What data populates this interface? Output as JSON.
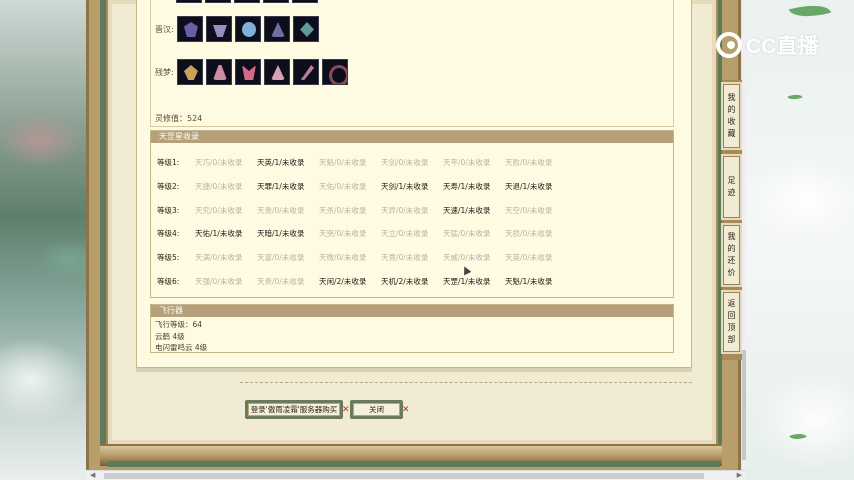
{
  "logo": {
    "text": "CC直播"
  },
  "items": {
    "row1_label": "晋汉:",
    "row1_icons": [
      "c1",
      "c2",
      "c3",
      "c4",
      "c5"
    ],
    "row2_label": "残梦:",
    "row2_icons": [
      "d1",
      "d2",
      "d3",
      "d4",
      "d5",
      "d6"
    ],
    "lingxiu": "灵修值：524"
  },
  "tianzhao": {
    "title": "天罡星收录",
    "rows": [
      {
        "label": "等级1:",
        "cells": [
          {
            "text": "天巧/0/未收录",
            "on": false
          },
          {
            "text": "天英/1/未收录",
            "on": true
          },
          {
            "text": "天魁/0/未收录",
            "on": false
          },
          {
            "text": "天剑/0/未收录",
            "on": false
          },
          {
            "text": "天平/0/未收录",
            "on": false
          },
          {
            "text": "天败/0/未收录",
            "on": false
          }
        ]
      },
      {
        "label": "等级2:",
        "cells": [
          {
            "text": "天捷/0/未收录",
            "on": false
          },
          {
            "text": "天罪/1/未收录",
            "on": true
          },
          {
            "text": "天佑/0/未收录",
            "on": false
          },
          {
            "text": "天剑/1/未收录",
            "on": true
          },
          {
            "text": "天寿/1/未收录",
            "on": true
          },
          {
            "text": "天退/1/未收录",
            "on": true
          }
        ]
      },
      {
        "label": "等级3:",
        "cells": [
          {
            "text": "天究/0/未收录",
            "on": false
          },
          {
            "text": "天贵/0/未收录",
            "on": false
          },
          {
            "text": "天杀/0/未收录",
            "on": false
          },
          {
            "text": "天异/0/未收录",
            "on": false
          },
          {
            "text": "天速/1/未收录",
            "on": true
          },
          {
            "text": "天空/0/未收录",
            "on": false
          }
        ]
      },
      {
        "label": "等级4:",
        "cells": [
          {
            "text": "天佑/1/未收录",
            "on": true
          },
          {
            "text": "天暗/1/未收录",
            "on": true
          },
          {
            "text": "天哭/0/未收录",
            "on": false
          },
          {
            "text": "天立/0/未收录",
            "on": false
          },
          {
            "text": "天猛/0/未收录",
            "on": false
          },
          {
            "text": "天损/0/未收录",
            "on": false
          }
        ]
      },
      {
        "label": "等级5:",
        "cells": [
          {
            "text": "天满/0/未收录",
            "on": false
          },
          {
            "text": "天富/0/未收录",
            "on": false
          },
          {
            "text": "天微/0/未收录",
            "on": false
          },
          {
            "text": "天竟/0/未收录",
            "on": false
          },
          {
            "text": "天威/0/未收录",
            "on": false
          },
          {
            "text": "天英/0/未收录",
            "on": false
          }
        ]
      },
      {
        "label": "等级6:",
        "cells": [
          {
            "text": "天强/0/未收录",
            "on": false
          },
          {
            "text": "天贵/0/未收录",
            "on": false
          },
          {
            "text": "天闲/2/未收录",
            "on": true
          },
          {
            "text": "天机/2/未收录",
            "on": true
          },
          {
            "text": "天罡/1/未收录",
            "on": true
          },
          {
            "text": "天魁/1/未收录",
            "on": true
          }
        ]
      }
    ]
  },
  "flight": {
    "title": "飞行器",
    "lines": [
      "飞行等级：64",
      "云鹤  4级",
      "电闪雷鸣云  4级"
    ]
  },
  "buttons": {
    "login": "登录'傲雨凌霜'服务器购买",
    "close": "关闭",
    "x_mark": "✕"
  },
  "sidebar": {
    "tabs": [
      {
        "chars": [
          "我",
          "的",
          "收",
          "藏"
        ]
      },
      {
        "chars": [
          "足",
          "迹"
        ]
      },
      {
        "chars": [
          "我",
          "的",
          "还",
          "价"
        ]
      },
      {
        "chars": [
          "返",
          "回",
          "顶",
          "部"
        ]
      }
    ]
  },
  "scroll": {
    "left_arrow": "◀",
    "right_arrow": "▶"
  }
}
